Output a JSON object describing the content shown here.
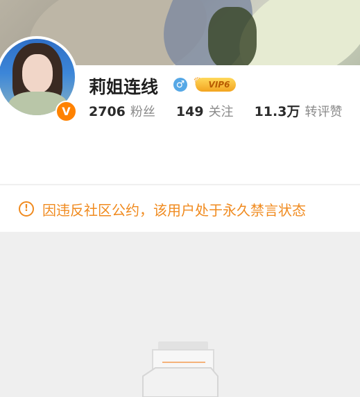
{
  "profile": {
    "name": "莉姐连线",
    "gender_symbol": "♂",
    "vip_label": "VIP6",
    "verified_mark": "V",
    "stats": [
      {
        "value": "2706",
        "label": "粉丝"
      },
      {
        "value": "149",
        "label": "关注"
      },
      {
        "value": "11.3万",
        "label": "转评赞"
      }
    ]
  },
  "notice": {
    "icon": "!",
    "text": "因违反社区公约，该用户处于永久禁言状态"
  },
  "colors": {
    "accent_orange": "#f08a1e",
    "vip_gold": "#f2a420",
    "gender_blue": "#56a8e6"
  }
}
